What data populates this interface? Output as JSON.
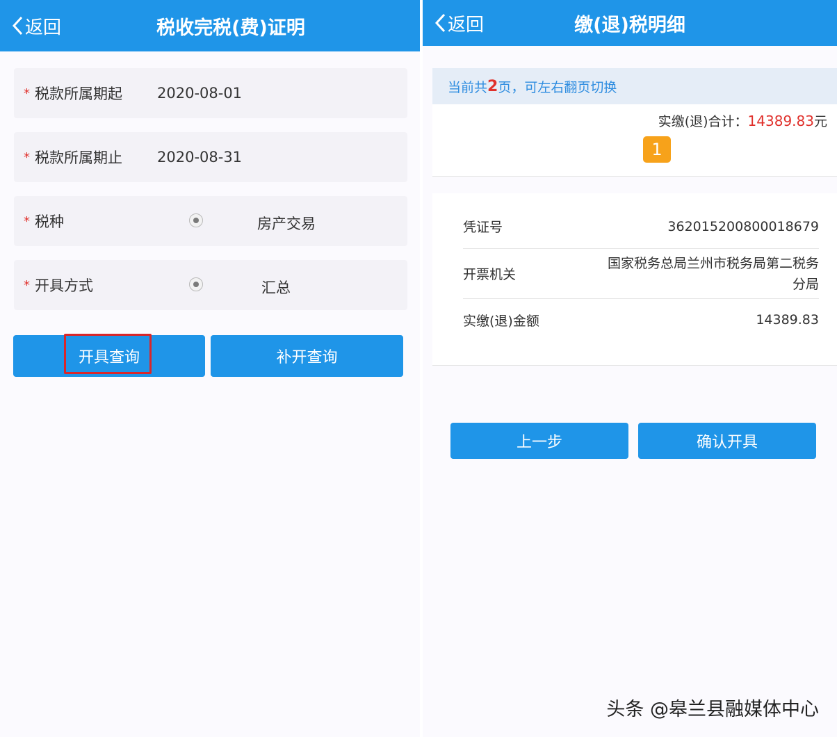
{
  "left": {
    "back_label": "返回",
    "title": "税收完税(费)证明",
    "rows": [
      {
        "label": "税款所属期起",
        "value": "2020-08-01"
      },
      {
        "label": "税款所属期止",
        "value": "2020-08-31"
      }
    ],
    "tax_type": {
      "label": "税种",
      "option": "房产交易"
    },
    "issue_method": {
      "label": "开具方式",
      "option": "汇总"
    },
    "required_mark": "*",
    "buttons": {
      "query": "开具查询",
      "reissue": "补开查询"
    }
  },
  "right": {
    "back_label": "返回",
    "title": "缴(退)税明细",
    "notice": {
      "prefix": "当前共",
      "pages": "2",
      "suffix": "页，可左右翻页切换"
    },
    "total": {
      "label": "实缴(退)合计：",
      "amount": "14389.83",
      "unit": "元"
    },
    "page_badge": "1",
    "details": [
      {
        "label": "凭证号",
        "value": "362015200800018679"
      },
      {
        "label": "开票机关",
        "value_line1": "国家税务总局兰州市税务局第二税务",
        "value_line2": "分局"
      },
      {
        "label": "实缴(退)金额",
        "value": "14389.83"
      }
    ],
    "buttons": {
      "prev": "上一步",
      "confirm": "确认开具"
    }
  },
  "watermark": "头条 @皋兰县融媒体中心",
  "colors": {
    "accent": "#1f95e8",
    "highlight": "#d9262a",
    "badge": "#f7a21a",
    "amount": "#e0312c"
  }
}
